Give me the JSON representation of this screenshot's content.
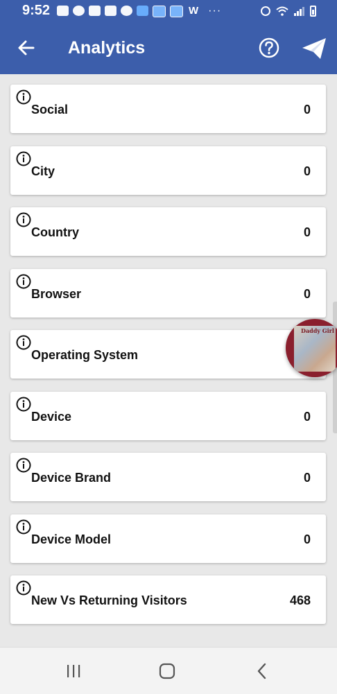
{
  "status_bar": {
    "time": "9:52",
    "notification_icons": [
      "chat-icon",
      "circle-icon",
      "youtube-icon",
      "message-icon",
      "fan-icon",
      "app-icon",
      "sd-icon",
      "sd-icon",
      "w-icon",
      "more-icon"
    ],
    "system_icons": [
      "alarm-icon",
      "wifi-icon",
      "signal-icon",
      "battery-icon"
    ]
  },
  "app_bar": {
    "title": "Analytics",
    "back_icon": "arrow-left-icon",
    "help_icon": "help-circle-icon",
    "send_icon": "paper-plane-icon",
    "background": "#3c5eab"
  },
  "metrics": [
    {
      "label": "Social",
      "value": "0"
    },
    {
      "label": "City",
      "value": "0"
    },
    {
      "label": "Country",
      "value": "0"
    },
    {
      "label": "Browser",
      "value": "0"
    },
    {
      "label": "Operating System",
      "value": ""
    },
    {
      "label": "Device",
      "value": "0"
    },
    {
      "label": "Device Brand",
      "value": "0"
    },
    {
      "label": "Device Model",
      "value": "0"
    },
    {
      "label": "New Vs Returning Visitors",
      "value": "468"
    }
  ],
  "bubble": {
    "text": "Daddy Girl"
  },
  "nav_bar": {
    "icons": [
      "recents-icon",
      "home-icon",
      "back-icon"
    ]
  }
}
